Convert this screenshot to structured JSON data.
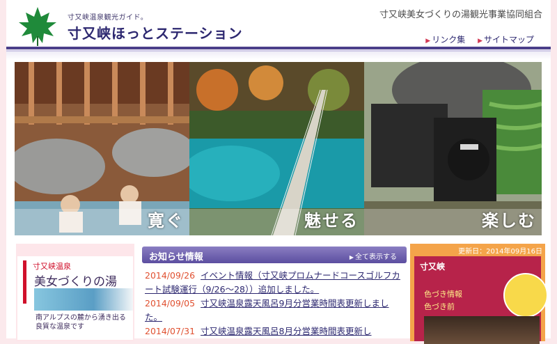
{
  "header": {
    "tagline": "寸又峡温泉観光ガイド。",
    "site_name": "寸又峡ほっとステーション",
    "organization": "寸又峡美女づくりの湯観光事業協同組合",
    "links": [
      {
        "label": "リンク集"
      },
      {
        "label": "サイトマップ"
      }
    ]
  },
  "hero": {
    "panels": [
      {
        "caption": "寛ぐ"
      },
      {
        "caption": "魅せる"
      },
      {
        "caption": "楽しむ"
      }
    ]
  },
  "promo": {
    "subtitle": "寸又峡温泉",
    "title": "美女づくりの湯",
    "description": "南アルプスの麓から湧き出る良質な温泉です"
  },
  "news": {
    "title": "お知らせ情報",
    "view_all": "全て表示する",
    "items": [
      {
        "date": "2014/09/26",
        "text": "イベント情報（寸又峡プロムナードコースゴルフカート試験運行（9/26〜28））追加しました。"
      },
      {
        "date": "2014/09/05",
        "text": "寸又峡温泉露天風呂9月分営業時間表更新しました。"
      },
      {
        "date": "2014/07/31",
        "text": "寸又峡温泉露天風呂8月分営業時間表更新し"
      }
    ]
  },
  "sidebar_right": {
    "updated": "更新日：2014年09月16日",
    "title": "寸又峡",
    "color_info": "色づき情報",
    "color_status": "色づき前"
  },
  "colors": {
    "brand": "#2d2870",
    "accent": "#d0102b",
    "news_header": "#5c4ea0",
    "date": "#e05030"
  }
}
